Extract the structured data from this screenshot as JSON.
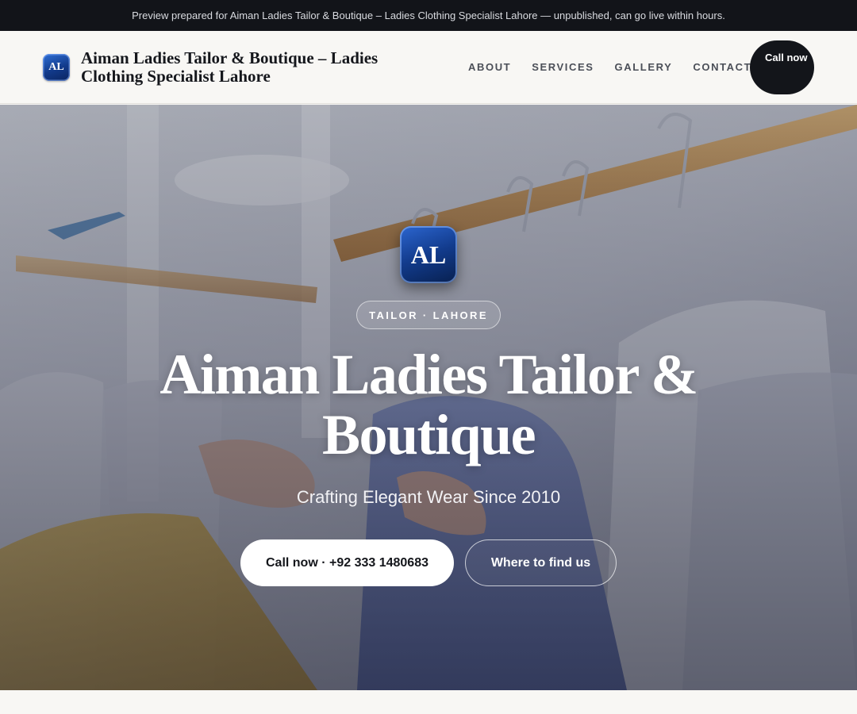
{
  "preview_banner": {
    "text": "Preview prepared for Aiman Ladies Tailor & Boutique – Ladies Clothing Specialist Lahore — unpublished, can go live within hours."
  },
  "header": {
    "logo_text": "AL",
    "brand_name": "Aiman Ladies Tailor & Boutique – Ladies Clothing Specialist Lahore",
    "nav": [
      {
        "label": "ABOUT"
      },
      {
        "label": "SERVICES"
      },
      {
        "label": "GALLERY"
      },
      {
        "label": "CONTACT"
      }
    ],
    "call_button": "Call now"
  },
  "hero": {
    "logo_text": "AL",
    "tag": "TAILOR · LAHORE",
    "title": "Aiman Ladies Tailor & Boutique",
    "subtitle": "Crafting Elegant Wear Since 2010",
    "primary_button": "Call now · +92 333 1480683",
    "secondary_button": "Where to find us",
    "background_image": "clothing-rack-hangers-photo"
  },
  "colors": {
    "banner_bg": "#121419",
    "logo_blue": "#123a8a",
    "dark_button": "#13151a",
    "page_bg": "#f8f7f4"
  }
}
